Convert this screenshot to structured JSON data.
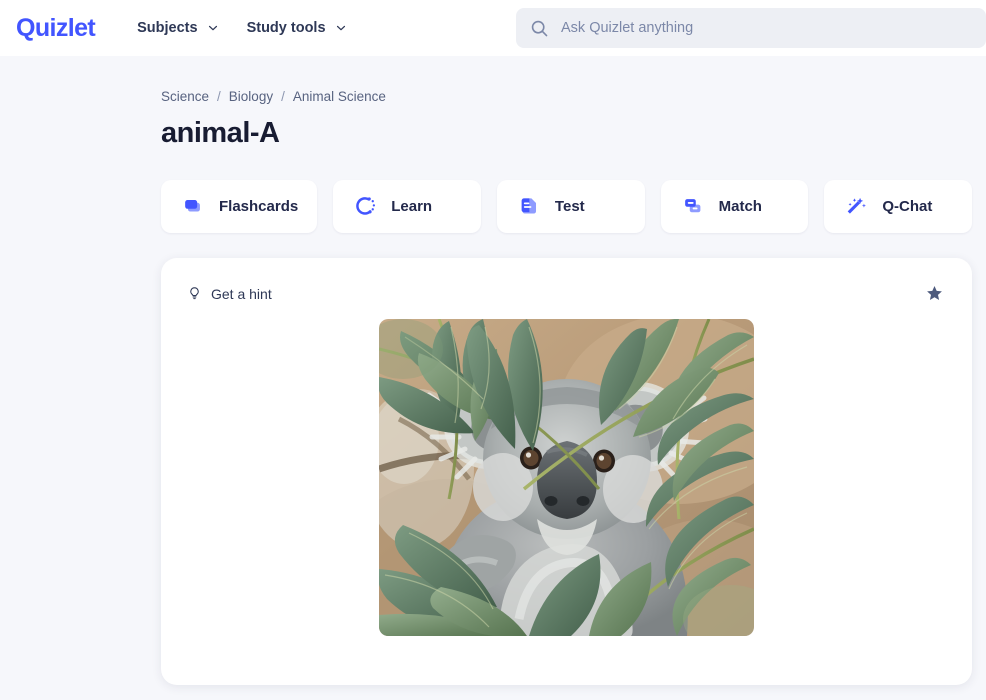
{
  "header": {
    "logo_text": "Quizlet",
    "nav": [
      {
        "label": "Subjects",
        "icon": "chevron-down-icon"
      },
      {
        "label": "Study tools",
        "icon": "chevron-down-icon"
      }
    ],
    "search": {
      "placeholder": "Ask Quizlet anything",
      "value": "",
      "icon": "search-icon"
    }
  },
  "breadcrumb": {
    "items": [
      "Science",
      "Biology",
      "Animal Science"
    ],
    "separator": "/"
  },
  "page_title": "animal-A",
  "modes": [
    {
      "label": "Flashcards",
      "icon": "flashcards-icon"
    },
    {
      "label": "Learn",
      "icon": "learn-icon"
    },
    {
      "label": "Test",
      "icon": "test-icon"
    },
    {
      "label": "Match",
      "icon": "match-icon"
    },
    {
      "label": "Q-Chat",
      "icon": "magic-wand-icon"
    }
  ],
  "flashcard": {
    "hint_label": "Get a hint",
    "hint_icon": "lightbulb-icon",
    "star_icon": "star-icon",
    "star_active": false,
    "image_alt": "koala in eucalyptus tree"
  },
  "colors": {
    "brand": "#4255ff",
    "accent_light": "#8e9bff",
    "page_bg": "#f6f7fb",
    "card_bg": "#ffffff",
    "text": "#23294b",
    "muted_text": "#586380",
    "search_bg": "#edeff4",
    "star": "#4d5a7d"
  }
}
